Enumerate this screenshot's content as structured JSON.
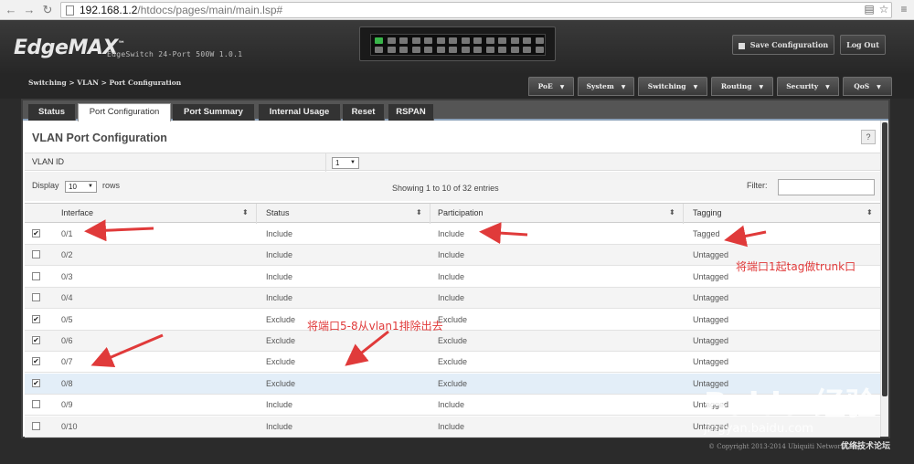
{
  "browser": {
    "url_host": "192.168.1.2",
    "url_path": "/htdocs/pages/main/main.lsp#"
  },
  "app": {
    "logo": "EdgeMAX",
    "product": "EdgeSwitch 24-Port 500W 1.0.1",
    "save_label": "Save Configuration",
    "logout_label": "Log Out"
  },
  "breadcrumb": "Switching > VLAN > Port Configuration",
  "menus": [
    "PoE",
    "System",
    "Switching",
    "Routing",
    "Security",
    "QoS"
  ],
  "tabs": [
    "Status",
    "Port Configuration",
    "Port Summary",
    "Internal Usage",
    "Reset",
    "RSPAN"
  ],
  "page": {
    "title": "VLAN Port Configuration",
    "help": "?",
    "vlan_id_label": "VLAN ID",
    "vlan_id_value": "1",
    "display_label": "Display",
    "display_value": "10",
    "rows_label": "rows",
    "showing": "Showing 1 to 10 of 32 entries",
    "filter_label": "Filter:"
  },
  "table": {
    "headers": [
      "Interface",
      "Status",
      "Participation",
      "Tagging"
    ],
    "rows": [
      {
        "checked": true,
        "interface": "0/1",
        "status": "Include",
        "participation": "Include",
        "tagging": "Tagged"
      },
      {
        "checked": false,
        "interface": "0/2",
        "status": "Include",
        "participation": "Include",
        "tagging": "Untagged"
      },
      {
        "checked": false,
        "interface": "0/3",
        "status": "Include",
        "participation": "Include",
        "tagging": "Untagged"
      },
      {
        "checked": false,
        "interface": "0/4",
        "status": "Include",
        "participation": "Include",
        "tagging": "Untagged"
      },
      {
        "checked": true,
        "interface": "0/5",
        "status": "Exclude",
        "participation": "Exclude",
        "tagging": "Untagged"
      },
      {
        "checked": true,
        "interface": "0/6",
        "status": "Exclude",
        "participation": "Exclude",
        "tagging": "Untagged"
      },
      {
        "checked": true,
        "interface": "0/7",
        "status": "Exclude",
        "participation": "Exclude",
        "tagging": "Untagged"
      },
      {
        "checked": true,
        "interface": "0/8",
        "status": "Exclude",
        "participation": "Exclude",
        "tagging": "Untagged"
      },
      {
        "checked": false,
        "interface": "0/9",
        "status": "Include",
        "participation": "Include",
        "tagging": "Untagged"
      },
      {
        "checked": false,
        "interface": "0/10",
        "status": "Include",
        "participation": "Include",
        "tagging": "Untagged"
      }
    ]
  },
  "annotations": {
    "tag_note": "将端口1起tag做trunk口",
    "exclude_note": "将端口5-8从vlan1排除出去"
  },
  "copyright": "© Copyright 2013-2014 Ubiquiti Networks, Inc.",
  "watermark": {
    "baidu": "Baidu 经验",
    "site": "jingyan.baidu.com",
    "brand": "优络技术论坛"
  },
  "colors": {
    "annotation": "#e03a3a",
    "active_port": "#39b54a"
  }
}
